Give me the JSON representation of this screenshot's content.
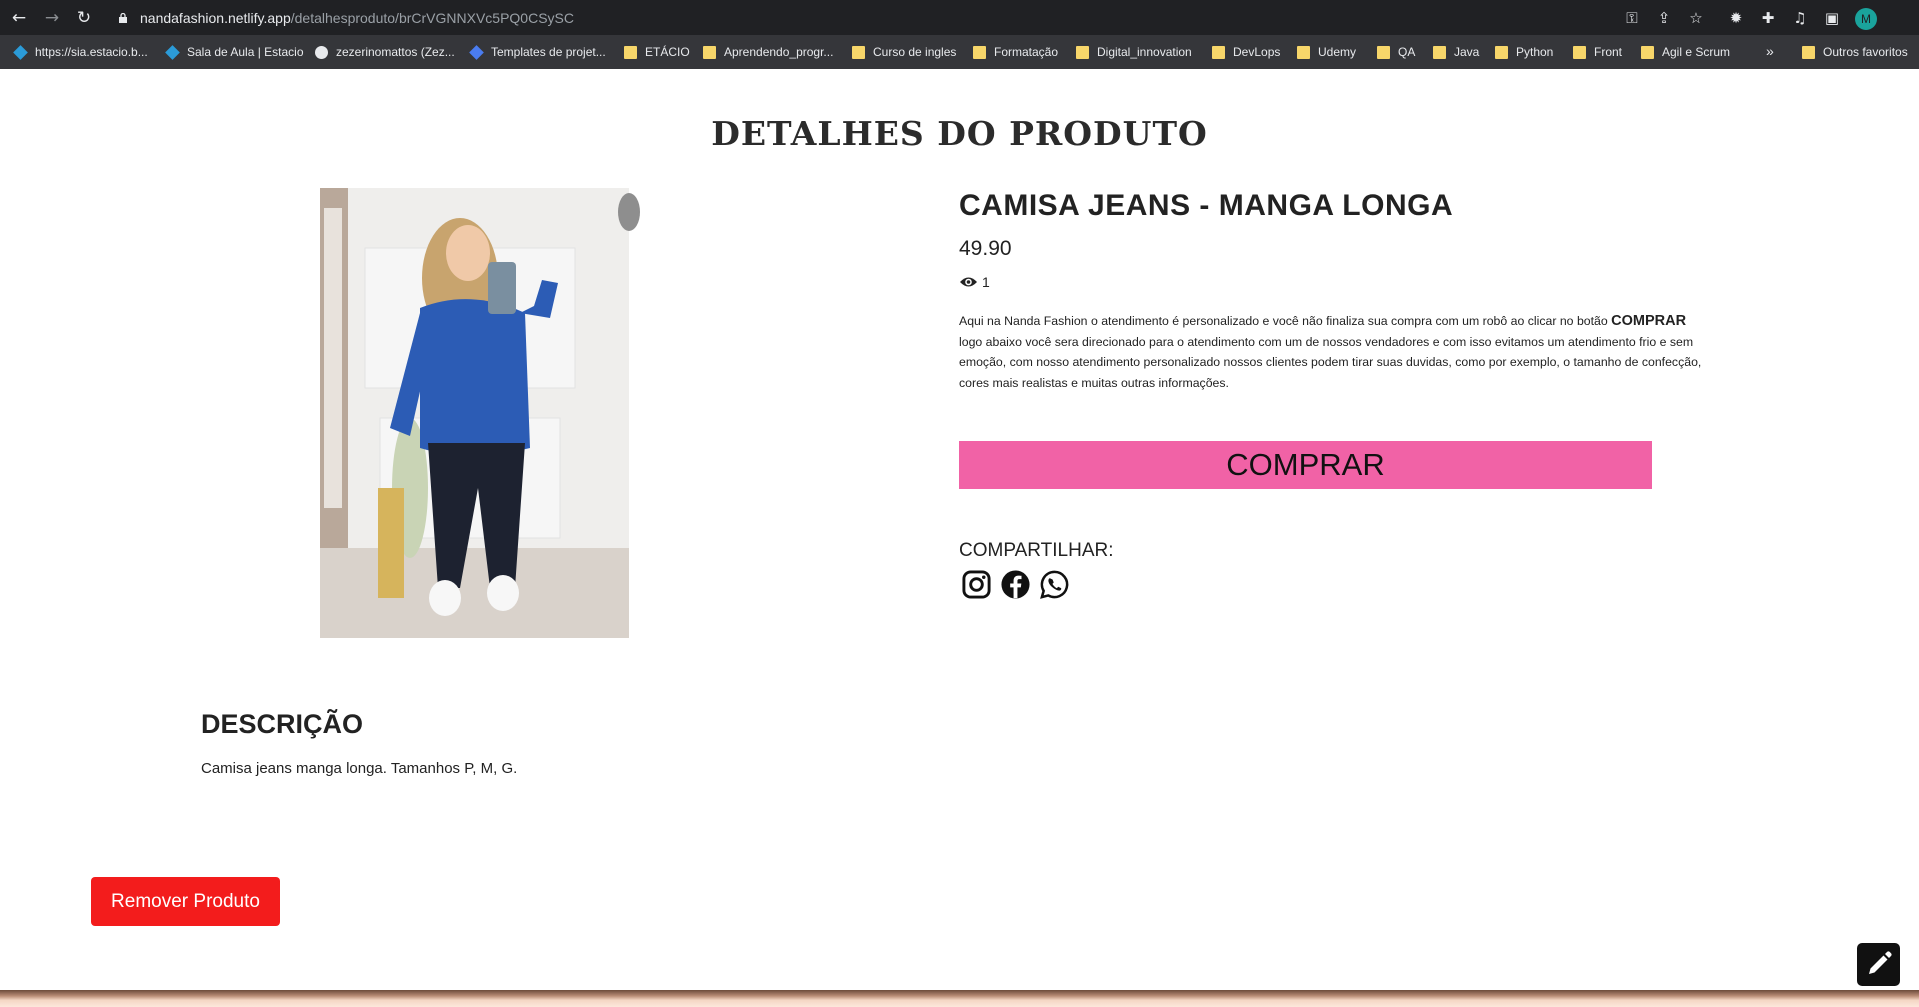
{
  "browser": {
    "url_host": "nandafashion.netlify.app",
    "url_path": "/detalhesproduto/brCrVGNNXVc5PQ0CSySC",
    "profile_initial": "M",
    "icons": [
      "back-icon",
      "forward-icon",
      "reload-icon",
      "lock-icon",
      "key-icon",
      "share-icon",
      "star-icon",
      "extension-icon",
      "puzzle-icon",
      "media-icon",
      "sidepanel-icon"
    ]
  },
  "bookmarks": {
    "items": [
      {
        "label": "https://sia.estacio.b...",
        "icon": "diamond"
      },
      {
        "label": "Sala de Aula | Estacio",
        "icon": "diamond"
      },
      {
        "label": "zezerinomattos (Zez...",
        "icon": "github"
      },
      {
        "label": "Templates de projet...",
        "icon": "diamond-blue"
      },
      {
        "label": "ETÁCIO",
        "icon": "folder"
      },
      {
        "label": "Aprendendo_progr...",
        "icon": "folder"
      },
      {
        "label": "Curso de ingles",
        "icon": "folder"
      },
      {
        "label": "Formatação",
        "icon": "folder"
      },
      {
        "label": "Digital_innovation",
        "icon": "folder"
      },
      {
        "label": "DevLops",
        "icon": "folder"
      },
      {
        "label": "Udemy",
        "icon": "folder"
      },
      {
        "label": "QA",
        "icon": "folder"
      },
      {
        "label": "Java",
        "icon": "folder"
      },
      {
        "label": "Python",
        "icon": "folder"
      },
      {
        "label": "Front",
        "icon": "folder"
      },
      {
        "label": "Agil e Scrum",
        "icon": "folder"
      }
    ],
    "more": "»",
    "other_favorites": "Outros favoritos"
  },
  "page": {
    "title": "DETALHES DO PRODUTO",
    "product": {
      "name": "CAMISA JEANS - MANGA LONGA",
      "price": "49.90",
      "views": "1",
      "info_before": "Aqui na Nanda Fashion o atendimento é personalizado e você não finaliza sua compra com um robô ao clicar no botão ",
      "info_bold": "COMPRAR",
      "info_after": " logo abaixo você sera direcionado para o atendimento com um de nossos vendadores e com isso evitamos um atendimento frio e sem emoção, com nosso atendimento personalizado nossos clientes podem tirar suas duvidas, como por exemplo, o tamanho de confecção, cores mais realistas e muitas outras informações.",
      "buy_label": "COMPRAR",
      "share_label": "COMPARTILHAR:",
      "share_icons": [
        "instagram-icon",
        "facebook-icon",
        "whatsapp-icon"
      ]
    },
    "description": {
      "title": "DESCRIÇÃO",
      "text": "Camisa jeans manga longa. Tamanhos P, M, G."
    },
    "remove_label": "Remover Produto"
  },
  "colors": {
    "buy_button": "#f162a6",
    "remove_button": "#f31c1c",
    "chrome_bg": "#202124",
    "bookmarks_bg": "#35363a"
  }
}
